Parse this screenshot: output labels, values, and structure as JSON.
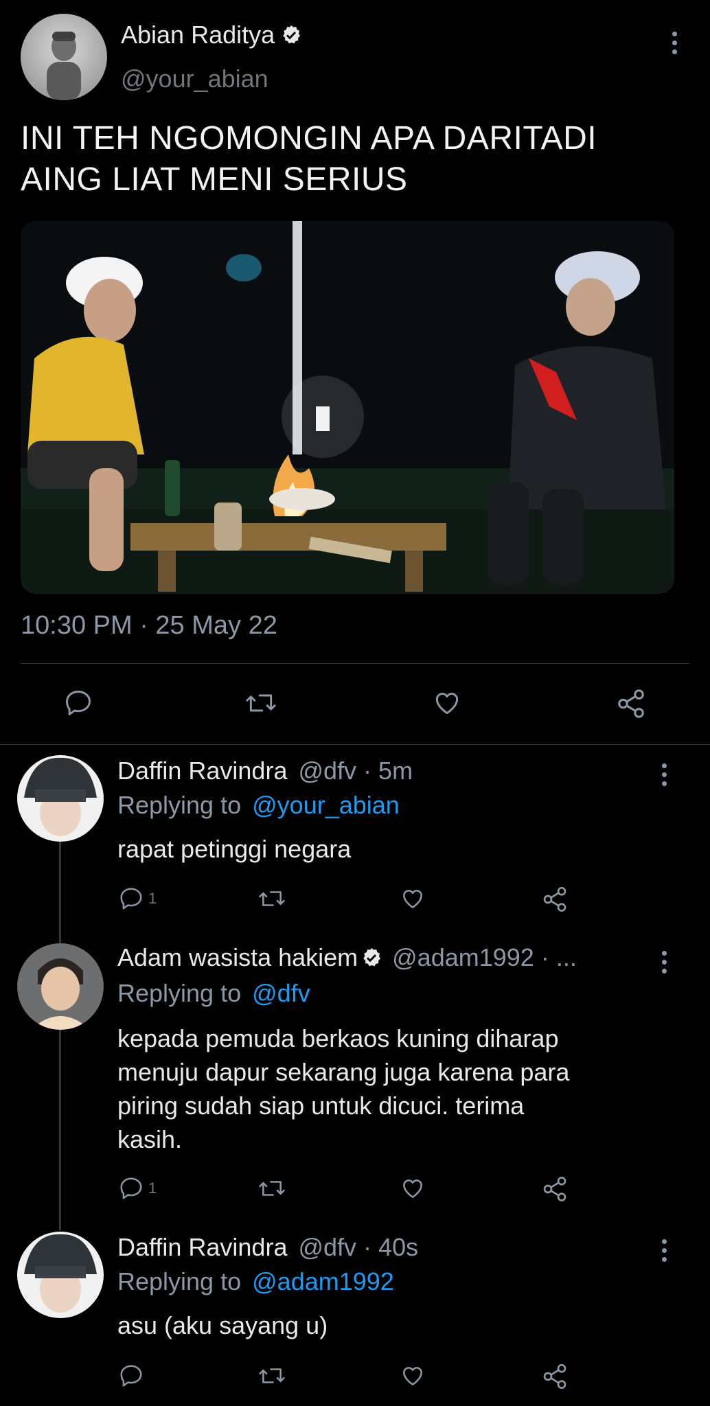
{
  "main_tweet": {
    "author_name": "Abian Raditya",
    "handle": "@your_abian",
    "text_line1": "INI TEH NGOMONGIN APA DARITADI",
    "text_line2": "AING LIAT MENI SERIUS",
    "timestamp": "10:30 PM · 25 May 22"
  },
  "replies": [
    {
      "name": "Daffin Ravindra",
      "handle_time": "@dfv · 5m",
      "replying_label": "Replying to",
      "replying_to": "@your_abian",
      "text": "rapat petinggi negara",
      "reply_count": "1"
    },
    {
      "name": "Adam wasista hakiem",
      "handle_time": "@adam1992 · ...",
      "replying_label": "Replying to",
      "replying_to": "@dfv",
      "text_lines": [
        "kepada pemuda berkaos kuning diharap",
        "menuju dapur sekarang juga karena para",
        "piring sudah siap untuk dicuci. terima",
        "kasih."
      ],
      "reply_count": "1"
    },
    {
      "name": "Daffin Ravindra",
      "handle_time": "@dfv · 40s",
      "replying_label": "Replying to",
      "replying_to": "@adam1992",
      "text": "asu (aku sayang u)",
      "reply_count": ""
    }
  ],
  "colors": {
    "background": "#000000",
    "text": "#e7e9ea",
    "muted": "#71767b",
    "link": "#1d9bf0",
    "divider": "#2f3336"
  },
  "icons": [
    "verified-badge-icon",
    "reply-icon",
    "retweet-icon",
    "like-icon",
    "share-icon",
    "more-options-icon"
  ]
}
